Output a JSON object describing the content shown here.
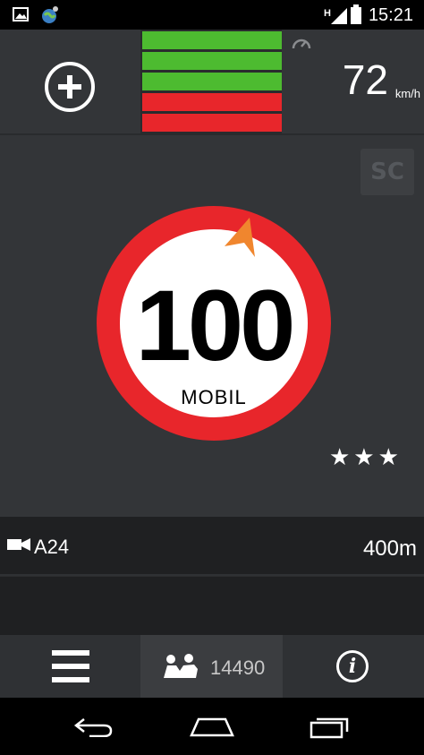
{
  "status_bar": {
    "time": "15:21",
    "network": "H"
  },
  "speed": {
    "value": "72",
    "unit": "km/h"
  },
  "traffic_bars": [
    "#4dbb30",
    "#4dbb30",
    "#4dbb30",
    "#e8262b",
    "#e8262b"
  ],
  "sc_label": "SC",
  "speed_limit": {
    "value": "100",
    "label": "MOBIL",
    "rating_stars": 3
  },
  "camera": {
    "road": "A24",
    "distance": "400m"
  },
  "bottom_nav": {
    "reports_count": "14490"
  },
  "colors": {
    "accent_red": "#e8262b",
    "accent_green": "#4dbb30",
    "arrow_orange": "#f0862e"
  }
}
